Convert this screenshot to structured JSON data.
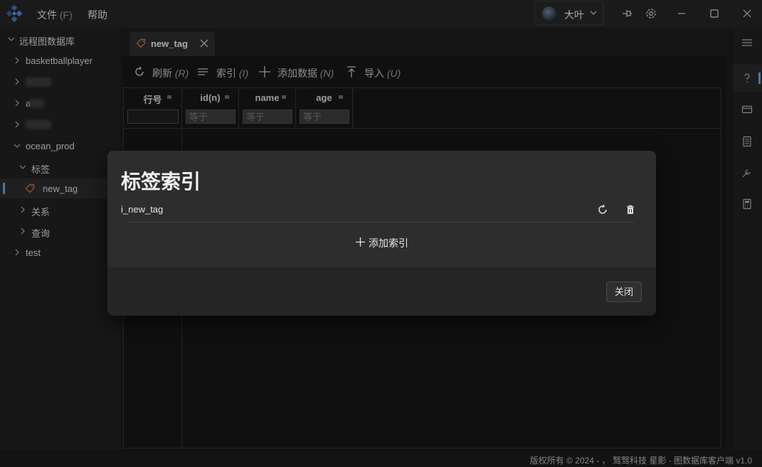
{
  "menu": {
    "file_label": "文件",
    "file_hotkey": "(F)",
    "help_label": "帮助"
  },
  "user": {
    "name": "大叶"
  },
  "sidebar": {
    "root_label": "远程图数据库",
    "items": [
      {
        "label": "basketballplayer"
      },
      {
        "label": ""
      },
      {
        "label": "a"
      },
      {
        "label": ""
      },
      {
        "label": "ocean_prod"
      },
      {
        "label": "标签"
      },
      {
        "label": "new_tag"
      },
      {
        "label": "关系"
      },
      {
        "label": "查询"
      },
      {
        "label": "test"
      }
    ]
  },
  "tabs": [
    {
      "label": "new_tag"
    }
  ],
  "toolbar": {
    "refresh_label": "刷新",
    "refresh_hotkey": "(R)",
    "index_label": "索引",
    "index_hotkey": "(I)",
    "add_data_label": "添加数据",
    "add_data_hotkey": "(N)",
    "import_label": "导入",
    "import_hotkey": "(U)"
  },
  "grid": {
    "columns": [
      {
        "name": "行号",
        "filter_placeholder": ""
      },
      {
        "name": "id(n)",
        "filter_placeholder": "等于"
      },
      {
        "name": "name",
        "filter_placeholder": "等于"
      },
      {
        "name": "age",
        "filter_placeholder": "等于"
      }
    ]
  },
  "modal": {
    "title": "标签索引",
    "indexes": [
      {
        "name": "i_new_tag"
      }
    ],
    "add_index_label": "添加索引",
    "close_label": "关闭"
  },
  "footer": {
    "text": "版权所有 © 2024 - ， 驽驽科技 星影 · 图数据库客户端 v1.0"
  },
  "colors": {
    "accent": "#6a9fd6",
    "tag_icon": "#d2734a",
    "background": "#1b1b1b",
    "modal": "#2d2d2d"
  },
  "icons": {
    "logo": "app-logo-icon",
    "pin": "pin-icon",
    "settings": "gear-icon",
    "minimize": "minimize-icon",
    "maximize": "maximize-icon",
    "close": "close-icon",
    "tag": "tag-icon",
    "refresh": "refresh-icon",
    "index": "list-icon",
    "add": "plus-icon",
    "import": "import-icon",
    "delete": "trash-icon",
    "rail": [
      "menu-icon",
      "help-icon",
      "card-icon",
      "document-icon",
      "tool-icon",
      "calculator-icon"
    ]
  }
}
